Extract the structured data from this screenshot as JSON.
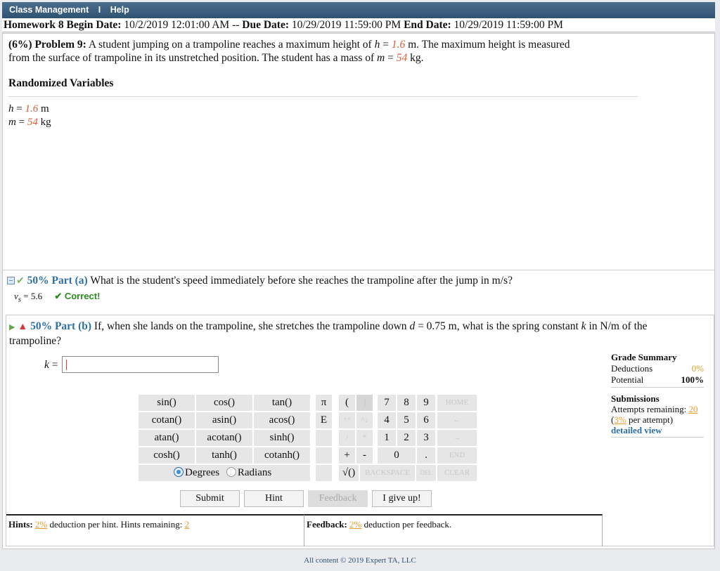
{
  "nav": {
    "class_management": "Class Management",
    "separator": "I",
    "help": "Help"
  },
  "homework": {
    "title": "Homework 8",
    "begin_label": "Begin Date:",
    "begin_value": "10/2/2019 12:01:00 AM",
    "dash": "--",
    "due_label": "Due Date:",
    "due_value": "10/29/2019 11:59:00 PM",
    "end_label": "End Date:",
    "end_value": "10/29/2019 11:59:00 PM"
  },
  "problem": {
    "weight": "(6%)",
    "label": "Problem 9:",
    "text_1": "A student jumping on a trampoline reaches a maximum height of",
    "h_sym": "h",
    "eq": "=",
    "h_val": "1.6",
    "h_unit": "m. The maximum height is measured",
    "text_2": "from the surface of trampoline in its unstretched position. The student has a mass of",
    "m_sym": "m",
    "m_val": "54",
    "m_unit": "kg."
  },
  "randomized": {
    "title": "Randomized Variables",
    "h_sym": "h",
    "h_eq": "=",
    "h_val": "1.6",
    "h_unit": "m",
    "m_sym": "m",
    "m_eq": "=",
    "m_val": "54",
    "m_unit": "kg"
  },
  "part_a": {
    "percent": "50%",
    "part": "Part (a)",
    "question": "What is the student's speed immediately before she reaches the trampoline after the jump in m/s?",
    "answer_sym": "v",
    "answer_sub": "s",
    "answer_val": "= 5.6",
    "status": "✔ Correct!"
  },
  "part_b": {
    "percent": "50%",
    "part": "Part (b)",
    "question_1": "If, when she lands on the trampoline, she stretches the trampoline down",
    "d_sym": "d",
    "d_val": "= 0.75 m, what is the spring constant",
    "k_sym": "k",
    "question_2": "in N/m of the",
    "question_3": "trampoline?",
    "input_label_sym": "k",
    "input_label_eq": "=",
    "input_value": ""
  },
  "grade_summary": {
    "title": "Grade Summary",
    "deductions_label": "Deductions",
    "deductions_value": "0%",
    "potential_label": "Potential",
    "potential_value": "100%"
  },
  "submissions": {
    "title": "Submissions",
    "attempts_label": "Attempts remaining:",
    "attempts_value": "20",
    "per_attempt_open": "(",
    "per_attempt_value": "3%",
    "per_attempt_label": "per attempt)",
    "detailed_view": "detailed view"
  },
  "calculator": {
    "functions": [
      "sin()",
      "cos()",
      "tan()",
      "cotan()",
      "asin()",
      "acos()",
      "atan()",
      "acotan()",
      "sinh()",
      "cosh()",
      "tanh()",
      "cotanh()"
    ],
    "degrees": "Degrees",
    "radians": "Radians",
    "pi": "π",
    "e": "E",
    "open_paren": "(",
    "close_paren": ")",
    "up": "↑^",
    "down": "^↓",
    "div": "/",
    "mul": "*",
    "plus": "+",
    "minus": "-",
    "digits": [
      "7",
      "8",
      "9",
      "4",
      "5",
      "6",
      "1",
      "2",
      "3",
      "0",
      "."
    ],
    "home": "HOME",
    "left": "←",
    "right": "→",
    "end": "END",
    "sqrt": "√()",
    "backspace": "BACKSPACE",
    "del": "DEL",
    "clear": "CLEAR"
  },
  "buttons": {
    "submit": "Submit",
    "hint": "Hint",
    "feedback": "Feedback",
    "give_up": "I give up!"
  },
  "hints": {
    "label": "Hints:",
    "pct": "2%",
    "text": "deduction per hint. Hints remaining:",
    "remaining": "2"
  },
  "feedback": {
    "label": "Feedback:",
    "pct": "2%",
    "text": "deduction per feedback."
  },
  "footer": "All content © 2019 Expert TA, LLC"
}
